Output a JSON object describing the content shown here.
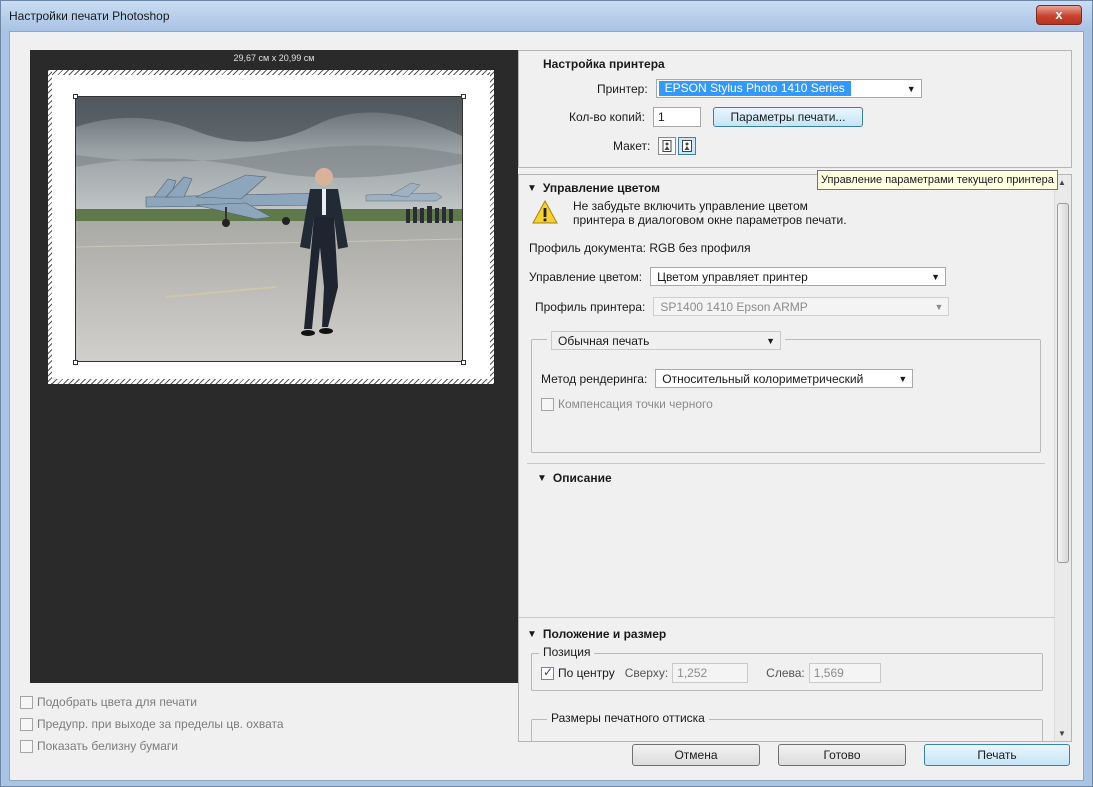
{
  "window": {
    "title": "Настройки печати Photoshop",
    "close_glyph": "x"
  },
  "preview": {
    "paper_size": "29,67 см x 20,99 см",
    "checks": [
      {
        "label": "Подобрать цвета для печати",
        "checked": false
      },
      {
        "label": "Предупр. при выходе за пределы цв. охвата",
        "checked": false
      },
      {
        "label": "Показать белизну бумаги",
        "checked": false
      }
    ]
  },
  "printer": {
    "title": "Настройка принтера",
    "printer_label": "Принтер:",
    "printer_value": "EPSON Stylus Photo 1410 Series",
    "copies_label": "Кол-во копий:",
    "copies_value": "1",
    "print_params_button": "Параметры печати...",
    "layout_label": "Макет:",
    "tooltip": "Управление параметрами текущего принтера"
  },
  "color": {
    "title": "Управление цветом",
    "warning_line1": "Не забудьте включить управление цветом",
    "warning_line2": "принтера в диалоговом окне параметров печати.",
    "doc_profile": "Профиль документа: RGB без профиля",
    "cm_label": "Управление цветом:",
    "cm_value": "Цветом управляет принтер",
    "printer_profile_label": "Профиль принтера:",
    "printer_profile_value": "SP1400 1410 Epson ARMP",
    "print_mode": "Обычная печать",
    "rendering_label": "Метод рендеринга:",
    "rendering_value": "Относительный колориметрический",
    "black_point": "Компенсация точки черного"
  },
  "description": {
    "title": "Описание"
  },
  "position": {
    "title": "Положение и размер",
    "group_label": "Позиция",
    "center_label": "По центру",
    "center_checked": true,
    "top_label": "Сверху:",
    "top_value": "1,252",
    "left_label": "Слева:",
    "left_value": "1,569",
    "print_size_label": "Размеры печатного оттиска"
  },
  "buttons": {
    "cancel": "Отмена",
    "done": "Готово",
    "print": "Печать"
  },
  "icons": {
    "close": "close-icon",
    "warning": "warning-icon",
    "portrait": "portrait-orientation-icon",
    "landscape": "landscape-orientation-icon"
  },
  "colors": {
    "accent": "#3399ff",
    "preview_bg": "#2a2a2a",
    "title_bar": "#a9c4e4",
    "tooltip_bg": "#ffffe1"
  }
}
